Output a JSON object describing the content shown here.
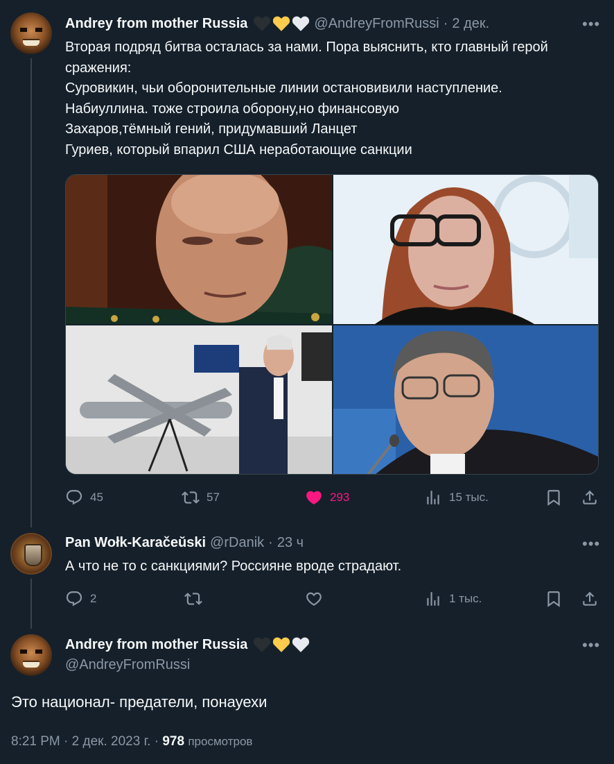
{
  "tweet1": {
    "author": "Andrey from mother Russia",
    "handle": "@AndreyFromRussi",
    "separator": "·",
    "date": "2 дек.",
    "hearts": [
      "black-heart",
      "yellow-heart",
      "white-heart"
    ],
    "lines": [
      "Вторая подряд битва осталась за нами. Пора выяснить, кто главный герой",
      "сражения:",
      "Суровикин, чьи оборонительные линии остановивили наступление.",
      "Набиуллина. тоже строила оборону,но финансовую",
      "Захаров,тёмный гений, придумавший Ланцет",
      "Гуриев, который впарил США неработающие санкции"
    ],
    "stats": {
      "replies": "45",
      "retweets": "57",
      "likes": "293",
      "views": "15 тыс."
    }
  },
  "reply": {
    "author": "Pan Wołk-Karačeŭski",
    "handle": "@rDanik",
    "separator": "·",
    "date": "23 ч",
    "text": "А что не то с санкциями? Россияне вроде страдают.",
    "stats": {
      "replies": "2",
      "views": "1 тыс."
    }
  },
  "main": {
    "author": "Andrey from mother Russia",
    "handle": "@AndreyFromRussi",
    "hearts": [
      "black-heart",
      "yellow-heart",
      "white-heart"
    ],
    "text": "Это национал- предатели, понауехи",
    "time": "8:21 PM",
    "separator": "·",
    "date": "2 дек. 2023 г.",
    "views_count": "978",
    "views_label": "просмотров"
  },
  "colors": {
    "background": "#15202b",
    "text": "#f7f9f9",
    "secondary": "#8b98a5",
    "like": "#f91880",
    "heart_black": "#292f33",
    "heart_yellow": "#ffcc4d",
    "heart_white": "#e7ebf0"
  }
}
